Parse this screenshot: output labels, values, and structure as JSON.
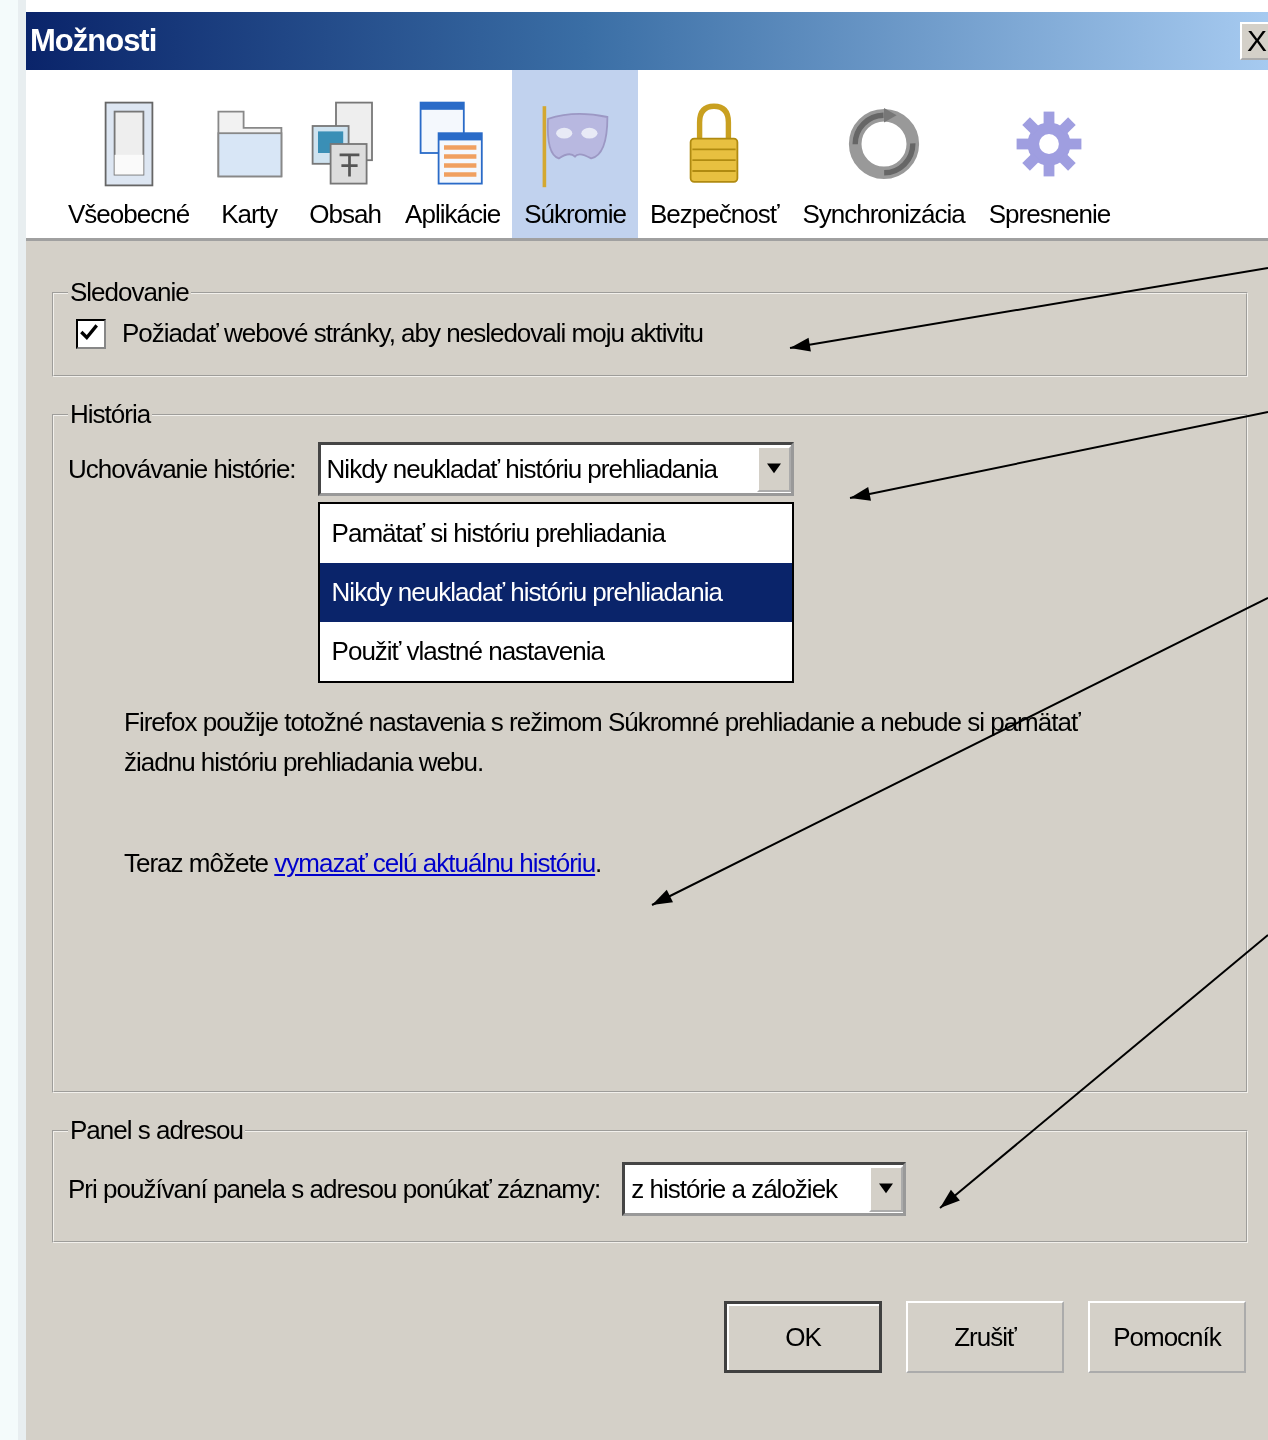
{
  "window": {
    "title": "Možnosti",
    "close": "X"
  },
  "tabs": [
    {
      "label": "Všeobecné",
      "selected": false
    },
    {
      "label": "Karty",
      "selected": false
    },
    {
      "label": "Obsah",
      "selected": false
    },
    {
      "label": "Aplikácie",
      "selected": false
    },
    {
      "label": "Súkromie",
      "selected": true
    },
    {
      "label": "Bezpečnosť",
      "selected": false
    },
    {
      "label": "Synchronizácia",
      "selected": false
    },
    {
      "label": "Spresnenie",
      "selected": false
    }
  ],
  "tracking": {
    "legend": "Sledovanie",
    "checkbox": {
      "label": "Požiadať webové stránky, aby nesledovali moju aktivitu",
      "checked": true
    }
  },
  "history": {
    "legend": "História",
    "label": "Uchovávanie histórie:",
    "select": {
      "value": "Nikdy neukladať históriu prehliadania",
      "expanded": true,
      "options": [
        {
          "label": "Pamätať si históriu prehliadania",
          "selected": false
        },
        {
          "label": "Nikdy neukladať históriu prehliadania",
          "selected": true
        },
        {
          "label": "Použiť vlastné nastavenia",
          "selected": false
        }
      ]
    },
    "description": "Firefox použije totožné nastavenia s režimom Súkromné prehliadanie a nebude si pamätať žiadnu históriu prehliadania webu.",
    "clear": {
      "before": "Teraz môžete ",
      "link": "vymazať celú aktuálnu históriu",
      "after": "."
    }
  },
  "address_bar": {
    "legend": "Panel s adresou",
    "label": "Pri používaní panela s adresou ponúkať záznamy:",
    "select": {
      "value": "z histórie a záložiek"
    }
  },
  "buttons": [
    {
      "label": "OK",
      "default": true
    },
    {
      "label": "Zrušiť",
      "default": false
    },
    {
      "label": "Pomocník",
      "default": false
    }
  ]
}
